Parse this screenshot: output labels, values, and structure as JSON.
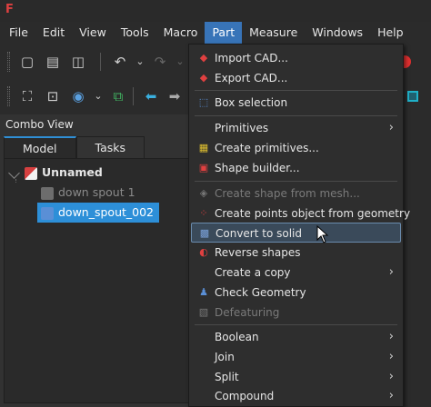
{
  "app": {
    "icon": "freecad-icon"
  },
  "menubar": {
    "items": [
      {
        "label": "File"
      },
      {
        "label": "Edit"
      },
      {
        "label": "View"
      },
      {
        "label": "Tools"
      },
      {
        "label": "Macro"
      },
      {
        "label": "Part"
      },
      {
        "label": "Measure"
      },
      {
        "label": "Windows"
      },
      {
        "label": "Help"
      }
    ]
  },
  "toolbar1": {
    "icons": [
      "new-file-icon",
      "open-file-icon",
      "save-icon",
      "undo-icon",
      "undo-dropdown-icon",
      "redo-icon",
      "redo-dropdown-icon"
    ]
  },
  "toolbar2": {
    "icons": [
      "fit-all-icon",
      "fit-selection-icon",
      "draw-style-icon",
      "draw-style-dropdown-icon",
      "sync-view-icon",
      "back-arrow-icon",
      "forward-arrow-icon"
    ]
  },
  "combo_view": {
    "title": "Combo View",
    "tabs": [
      {
        "label": "Model"
      },
      {
        "label": "Tasks"
      }
    ],
    "tree": {
      "root": "Unnamed",
      "children": [
        {
          "label": "down spout 1",
          "state": "hidden"
        },
        {
          "label": "down_spout_002",
          "state": "selected"
        }
      ]
    }
  },
  "part_menu": {
    "items": [
      {
        "label": "Import CAD...",
        "icon": "import-cad-icon"
      },
      {
        "label": "Export CAD...",
        "icon": "export-cad-icon"
      },
      {
        "label": "Box selection",
        "icon": "box-selection-icon"
      },
      {
        "label": "Primitives",
        "submenu": true
      },
      {
        "label": "Create primitives...",
        "icon": "create-primitives-icon"
      },
      {
        "label": "Shape builder...",
        "icon": "shape-builder-icon"
      },
      {
        "label": "Create shape from mesh...",
        "icon": "shape-from-mesh-icon",
        "disabled": true
      },
      {
        "label": "Create points object from geometry",
        "icon": "points-object-icon"
      },
      {
        "label": "Convert to solid",
        "icon": "convert-solid-icon",
        "hover": true
      },
      {
        "label": "Reverse shapes",
        "icon": "reverse-shapes-icon"
      },
      {
        "label": "Create a copy",
        "submenu": true
      },
      {
        "label": "Check Geometry",
        "icon": "check-geometry-icon"
      },
      {
        "label": "Defeaturing",
        "icon": "defeaturing-icon",
        "disabled": true
      },
      {
        "label": "Boolean",
        "submenu": true
      },
      {
        "label": "Join",
        "submenu": true
      },
      {
        "label": "Split",
        "submenu": true
      },
      {
        "label": "Compound",
        "submenu": true
      }
    ]
  },
  "colors": {
    "accent": "#3874b8",
    "selection": "#2d8fd8",
    "hover_border": "#6a8bad"
  }
}
